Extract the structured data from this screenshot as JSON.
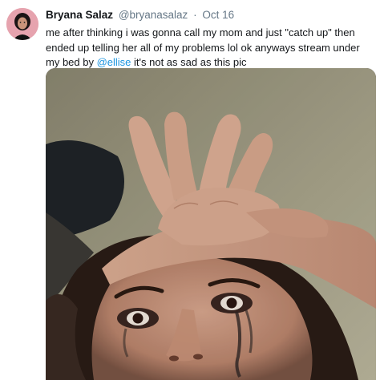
{
  "tweet": {
    "author_name": "Bryana Salaz",
    "author_handle": "@bryanasalaz",
    "separator": "·",
    "date": "Oct 16",
    "text_part1": "me after thinking i was gonna call my mom and just \"catch up\" then ended up telling her all of my problems lol ok anyways stream under my bed by ",
    "mention": "@ellise",
    "text_part2": " it's not as sad as this pic",
    "avatar_icon": "profile-avatar-icon",
    "media_icon": "selfie-photo"
  },
  "colors": {
    "text": "#14171a",
    "secondary": "#657786",
    "link": "#1b95e0",
    "background": "#ffffff"
  }
}
